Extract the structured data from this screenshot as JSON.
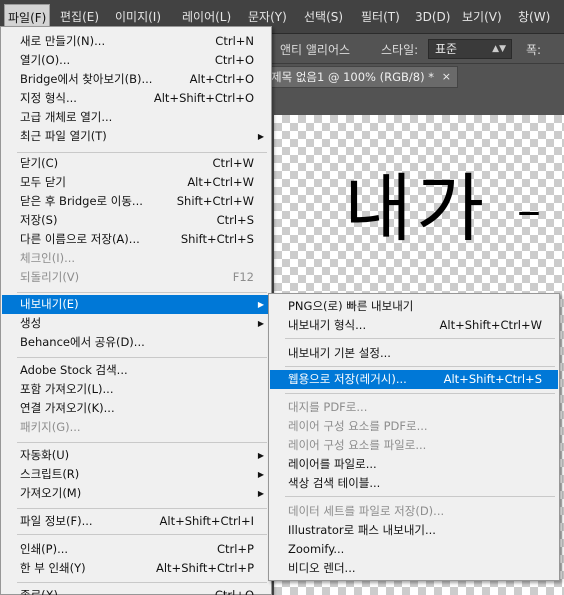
{
  "menubar": {
    "items": [
      {
        "label": "파일(F)",
        "active": true
      },
      {
        "label": "편집(E)"
      },
      {
        "label": "이미지(I)"
      },
      {
        "label": "레이어(L)"
      },
      {
        "label": "문자(Y)"
      },
      {
        "label": "선택(S)"
      },
      {
        "label": "필터(T)"
      },
      {
        "label": "3D(D)"
      },
      {
        "label": "보기(V)"
      },
      {
        "label": "창(W)"
      }
    ]
  },
  "options_bar": {
    "antialias_label": "앤티 앨리어스",
    "style_label": "스타일:",
    "style_value": "표준",
    "width_label": "폭:"
  },
  "document": {
    "tab_title": "제목 없음1 @ 100% (RGB/8) *",
    "close_glyph": "×",
    "canvas_text": "내가 -"
  },
  "file_menu": {
    "items": [
      {
        "label": "새로 만들기(N)...",
        "shortcut": "Ctrl+N"
      },
      {
        "label": "열기(O)...",
        "shortcut": "Ctrl+O"
      },
      {
        "label": "Bridge에서 찾아보기(B)...",
        "shortcut": "Alt+Ctrl+O"
      },
      {
        "label": "지정 형식...",
        "shortcut": "Alt+Shift+Ctrl+O"
      },
      {
        "label": "고급 개체로 열기..."
      },
      {
        "label": "최근 파일 열기(T)",
        "submenu": true
      },
      {
        "label": "닫기(C)",
        "shortcut": "Ctrl+W"
      },
      {
        "label": "모두 닫기",
        "shortcut": "Alt+Ctrl+W"
      },
      {
        "label": "닫은 후 Bridge로 이동...",
        "shortcut": "Shift+Ctrl+W"
      },
      {
        "label": "저장(S)",
        "shortcut": "Ctrl+S"
      },
      {
        "label": "다른 이름으로 저장(A)...",
        "shortcut": "Shift+Ctrl+S"
      },
      {
        "label": "체크인(I)...",
        "disabled": true
      },
      {
        "label": "되돌리기(V)",
        "shortcut": "F12",
        "disabled": true
      },
      {
        "label": "내보내기(E)",
        "submenu": true,
        "highlight": true
      },
      {
        "label": "생성",
        "submenu": true
      },
      {
        "label": "Behance에서 공유(D)..."
      },
      {
        "label": "Adobe Stock 검색..."
      },
      {
        "label": "포함 가져오기(L)..."
      },
      {
        "label": "연결 가져오기(K)..."
      },
      {
        "label": "패키지(G)...",
        "disabled": true
      },
      {
        "label": "자동화(U)",
        "submenu": true
      },
      {
        "label": "스크립트(R)",
        "submenu": true
      },
      {
        "label": "가져오기(M)",
        "submenu": true
      },
      {
        "label": "파일 정보(F)...",
        "shortcut": "Alt+Shift+Ctrl+I"
      },
      {
        "label": "인쇄(P)...",
        "shortcut": "Ctrl+P"
      },
      {
        "label": "한 부 인쇄(Y)",
        "shortcut": "Alt+Shift+Ctrl+P"
      },
      {
        "label": "종료(X)",
        "shortcut": "Ctrl+Q"
      }
    ]
  },
  "export_menu": {
    "items": [
      {
        "label": "PNG으(로) 빠른 내보내기"
      },
      {
        "label": "내보내기 형식...",
        "shortcut": "Alt+Shift+Ctrl+W"
      },
      {
        "label": "내보내기 기본 설정..."
      },
      {
        "label": "웹용으로 저장(레거시)...",
        "shortcut": "Alt+Shift+Ctrl+S",
        "highlight": true
      },
      {
        "label": "대지를 PDF로...",
        "disabled": true
      },
      {
        "label": "레이어 구성 요소를 PDF로...",
        "disabled": true
      },
      {
        "label": "레이어 구성 요소를 파일로...",
        "disabled": true
      },
      {
        "label": "레이어를 파일로..."
      },
      {
        "label": "색상 검색 테이블..."
      },
      {
        "label": "데이터 세트를 파일로 저장(D)...",
        "disabled": true
      },
      {
        "label": "Illustrator로 패스 내보내기..."
      },
      {
        "label": "Zoomify..."
      },
      {
        "label": "비디오 렌더..."
      }
    ]
  }
}
